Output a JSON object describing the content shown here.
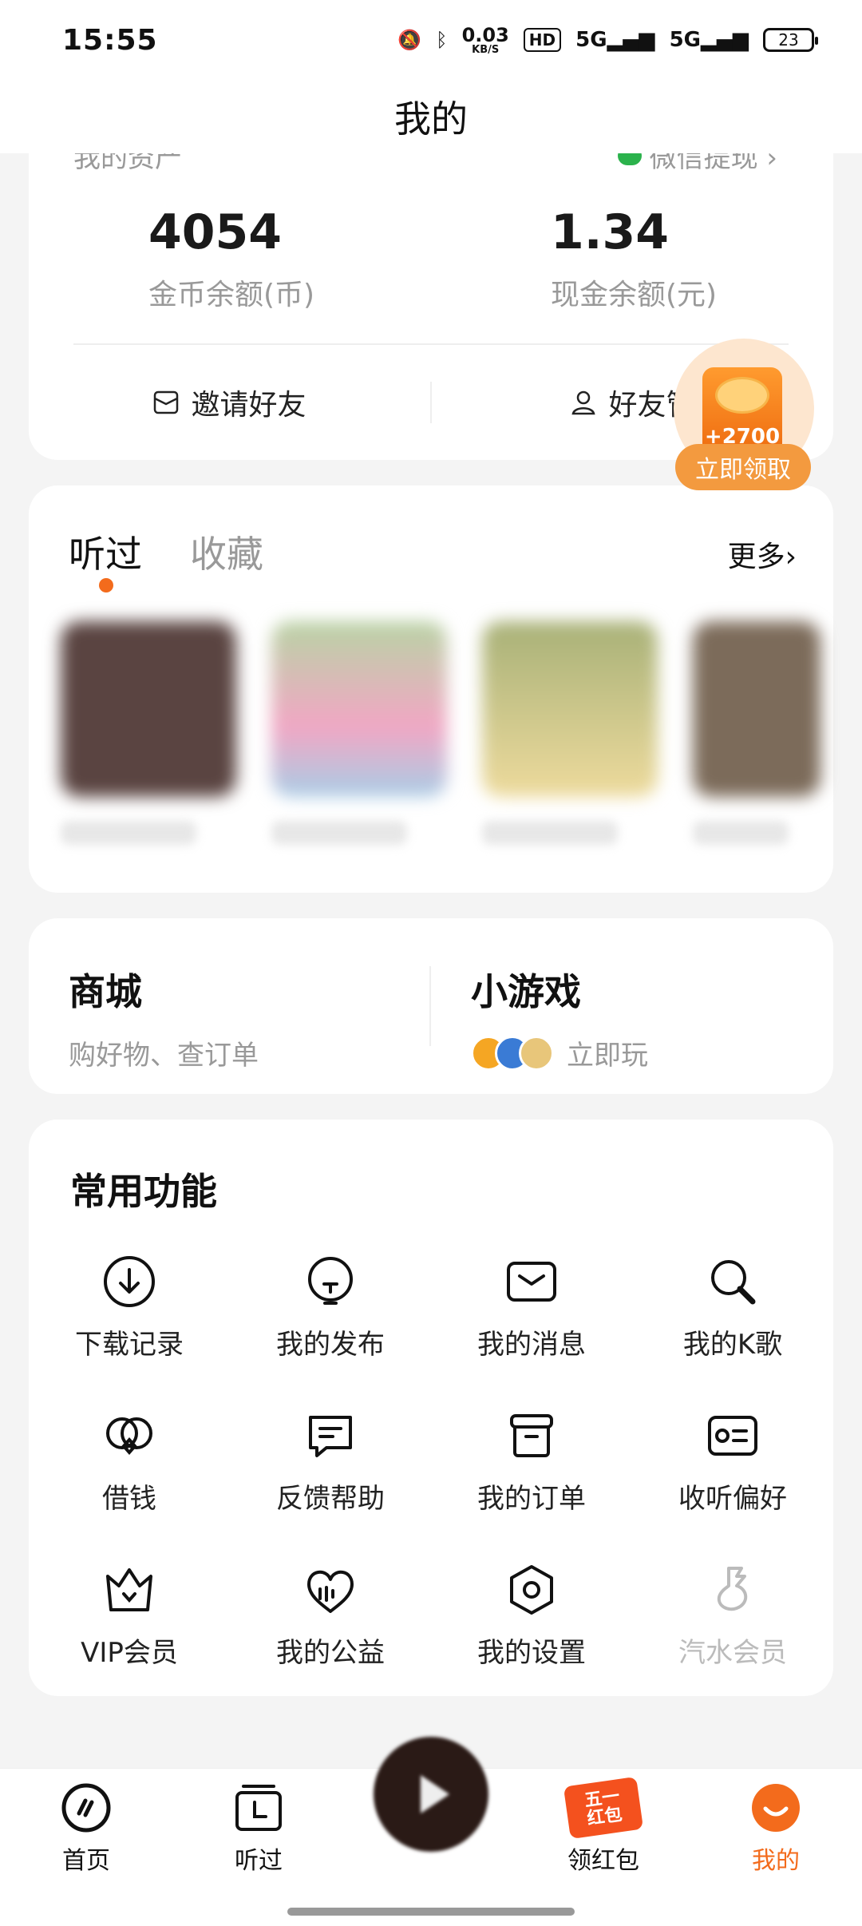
{
  "status_bar": {
    "time": "15:55",
    "net_speed_value": "0.03",
    "net_speed_unit": "KB/S",
    "hd_label": "HD",
    "signal1": "5G",
    "signal2": "5G",
    "battery": "23"
  },
  "header": {
    "title": "我的"
  },
  "wallet": {
    "peek_left": "我的资产",
    "peek_right": "微信提现 ›",
    "coins_value": "4054",
    "coins_label": "金币余额(币)",
    "cash_value": "1.34",
    "cash_label": "现金余额(元)",
    "invite_label": "邀请好友",
    "friends_label": "好友管"
  },
  "coin_badge": {
    "amount": "+2700",
    "claim_label": "立即领取"
  },
  "listened": {
    "tab_active": "听过",
    "tab_inactive": "收藏",
    "more_label": "更多›"
  },
  "mall": {
    "mall_title": "商城",
    "mall_sub": "购好物、查订单",
    "game_title": "小游戏",
    "game_sub": "立即玩"
  },
  "functions": {
    "heading": "常用功能",
    "items": [
      {
        "label": "下载记录",
        "icon": "download-icon"
      },
      {
        "label": "我的发布",
        "icon": "publish-icon"
      },
      {
        "label": "我的消息",
        "icon": "message-icon"
      },
      {
        "label": "我的K歌",
        "icon": "karaoke-icon"
      },
      {
        "label": "借钱",
        "icon": "loan-icon"
      },
      {
        "label": "反馈帮助",
        "icon": "feedback-icon"
      },
      {
        "label": "我的订单",
        "icon": "order-icon"
      },
      {
        "label": "收听偏好",
        "icon": "preference-icon"
      },
      {
        "label": "VIP会员",
        "icon": "crown-icon"
      },
      {
        "label": "我的公益",
        "icon": "charity-icon"
      },
      {
        "label": "我的设置",
        "icon": "settings-icon"
      },
      {
        "label": "汽水会员",
        "icon": "soda-icon"
      }
    ]
  },
  "bottom_nav": {
    "home": "首页",
    "history": "听过",
    "red_packet": "领红包",
    "red_packet_badge_top": "五一",
    "red_packet_badge_bottom": "红包",
    "mine": "我的"
  },
  "colors": {
    "accent": "#f36b1c",
    "card_bg": "#ffffff",
    "page_bg": "#f4f4f4"
  }
}
